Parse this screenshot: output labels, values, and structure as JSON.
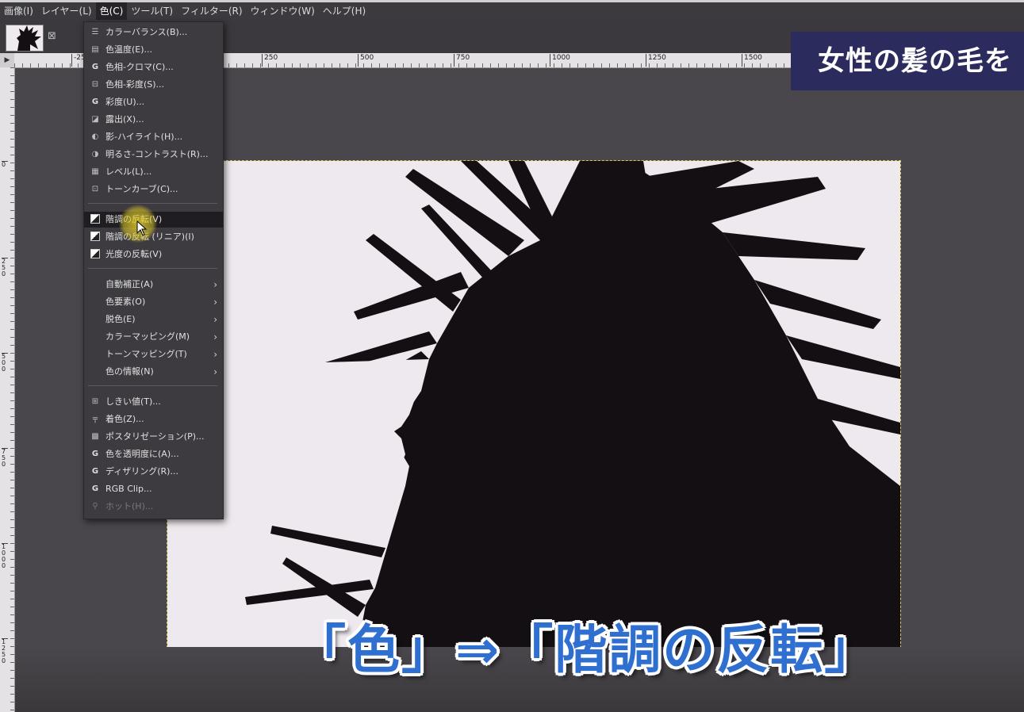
{
  "menubar": {
    "items": [
      "画像(I)",
      "レイヤー(L)",
      "色(C)",
      "ツール(T)",
      "フィルター(R)",
      "ウィンドウ(W)",
      "ヘルプ(H)"
    ],
    "active_index": 2
  },
  "tab": {
    "close_glyph": "⊠"
  },
  "ruler": {
    "h_labels": [
      "-25",
      "250",
      "500",
      "750",
      "1000",
      "1250",
      "1500"
    ],
    "v_labels": [
      "0",
      "250",
      "500",
      "750",
      "1000",
      "1250"
    ]
  },
  "color_menu": {
    "items": [
      {
        "label": "カラーバランス(B)...",
        "icon": "balance-icon"
      },
      {
        "label": "色温度(E)...",
        "icon": "temperature-icon"
      },
      {
        "label": "色相-クロマ(C)...",
        "icon": "gegl-icon"
      },
      {
        "label": "色相-彩度(S)...",
        "icon": "hue-saturation-icon"
      },
      {
        "label": "彩度(U)...",
        "icon": "gegl-icon"
      },
      {
        "label": "露出(X)...",
        "icon": "exposure-icon"
      },
      {
        "label": "影-ハイライト(H)...",
        "icon": "shadow-icon"
      },
      {
        "label": "明るさ-コントラスト(R)...",
        "icon": "contrast-icon"
      },
      {
        "label": "レベル(L)...",
        "icon": "levels-icon"
      },
      {
        "label": "トーンカーブ(C)...",
        "icon": "curves-icon"
      },
      {
        "label": "階調の反転(V)",
        "icon": "invert-icon"
      },
      {
        "label": "階調の反転 (リニア)(I)",
        "icon": "invert-icon"
      },
      {
        "label": "光度の反転(V)",
        "icon": "invert-icon"
      },
      {
        "label": "自動補正(A)",
        "icon": ""
      },
      {
        "label": "色要素(O)",
        "icon": ""
      },
      {
        "label": "脱色(E)",
        "icon": ""
      },
      {
        "label": "カラーマッピング(M)",
        "icon": ""
      },
      {
        "label": "トーンマッピング(T)",
        "icon": ""
      },
      {
        "label": "色の情報(N)",
        "icon": ""
      },
      {
        "label": "しきい値(T)...",
        "icon": "threshold-icon"
      },
      {
        "label": "着色(Z)...",
        "icon": "colorize-icon"
      },
      {
        "label": "ポスタリゼーション(P)...",
        "icon": "posterize-icon"
      },
      {
        "label": "色を透明度に(A)...",
        "icon": "gegl-icon"
      },
      {
        "label": "ディザリング(R)...",
        "icon": "gegl-icon"
      },
      {
        "label": "RGB Clip...",
        "icon": "gegl-icon"
      },
      {
        "label": "ホット(H)...",
        "icon": "hot-icon"
      }
    ],
    "highlighted_index": 10,
    "disabled_index": 25,
    "submenu_arrow": "›"
  },
  "banner": {
    "text": "女性の髪の毛を"
  },
  "caption": {
    "text": "「色」⇒「階調の反転」"
  },
  "colors": {
    "menu_bg": "#3d3b40",
    "image_bg": "#eee9ee",
    "silhouette": "#130f13",
    "caption_blue": "#2f6fd0",
    "banner_bg": "#2c2b5e"
  }
}
